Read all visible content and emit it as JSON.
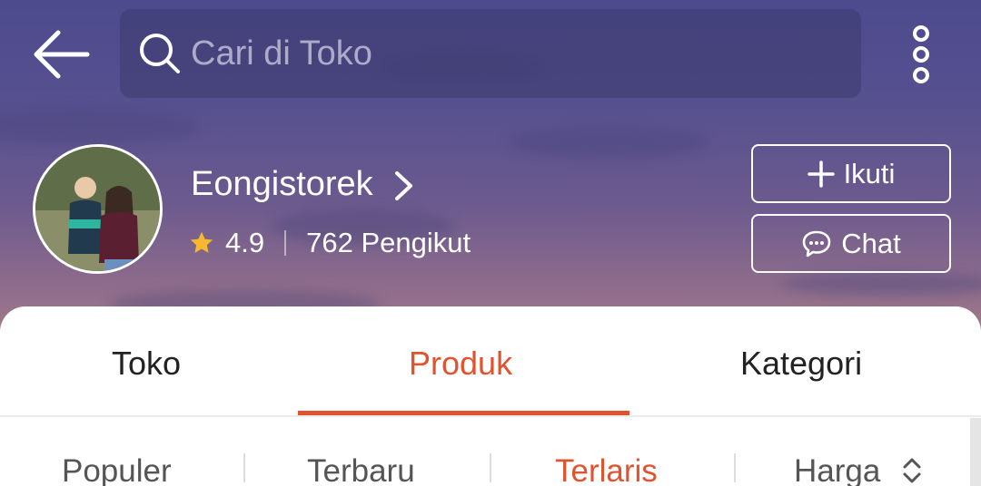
{
  "header": {
    "search_placeholder": "Cari di Toko"
  },
  "shop": {
    "name": "Eongistorek",
    "rating": "4.9",
    "followers": "762 Pengikut",
    "follow_label": "Ikuti",
    "chat_label": "Chat"
  },
  "tabs": [
    {
      "label": "Toko",
      "active": false
    },
    {
      "label": "Produk",
      "active": true
    },
    {
      "label": "Kategori",
      "active": false
    }
  ],
  "sort_options": [
    {
      "label": "Populer",
      "active": false
    },
    {
      "label": "Terbaru",
      "active": false
    },
    {
      "label": "Terlaris",
      "active": true
    },
    {
      "label": "Harga",
      "active": false
    }
  ],
  "colors": {
    "accent": "#e0532e",
    "star": "#f5b82e",
    "hero_top": "#4d4a8e",
    "hero_bottom": "#a27a8a"
  },
  "icons": {
    "back": "arrow-left-icon",
    "search": "search-icon",
    "more": "more-vertical-icon",
    "chevron": "chevron-right-icon",
    "star": "star-icon",
    "plus": "plus-icon",
    "chat": "chat-bubble-icon",
    "sort": "sort-caret-icon"
  }
}
